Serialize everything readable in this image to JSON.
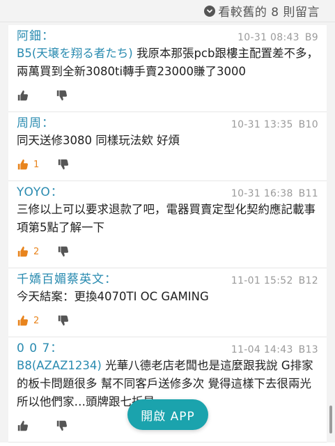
{
  "header": {
    "toggle_label": "看較舊的 8 則留言",
    "icon": "chevron-down-icon"
  },
  "comments": [
    {
      "author": "阿鈿：",
      "time": "10-31 08:43",
      "floor": "B9",
      "mention": "B5(天壌を翔る者たち)",
      "text": " 我原本那張pcb跟樓主配置差不多，兩萬買到全新3080ti轉手賣23000賺了3000",
      "likes": "",
      "liked": false
    },
    {
      "author": "周周：",
      "time": "10-31 13:35",
      "floor": "B10",
      "mention": "",
      "text": "同天送修3080 同樣玩法欸 好煩",
      "likes": "1",
      "liked": true
    },
    {
      "author": "YOYO：",
      "time": "10-31 16:38",
      "floor": "B11",
      "mention": "",
      "text": "三修以上可以要求退款了吧，電器買賣定型化契約應記載事項第5點了解一下",
      "likes": "2",
      "liked": true
    },
    {
      "author": "千嬌百媚蔡英文：",
      "time": "11-01 15:52",
      "floor": "B12",
      "mention": "",
      "text": "今天結案：更換4070TI OC GAMING",
      "likes": "2",
      "liked": true
    },
    {
      "author": "0 0 7：",
      "time": "11-04 14:43",
      "floor": "B13",
      "mention": "B8(AZAZ1234)",
      "text": " 光華八德老店老闆也是這麼跟我說 G排家的板卡問題很多 幫不同客戶送修多次 覺得這樣下去很兩光 所以他們家",
      "hidden_text": "…頭牌跟七折星",
      "likes": "",
      "liked": false
    }
  ],
  "open_app": {
    "label": "開啟 APP"
  },
  "colors": {
    "accent": "#2a8bb0",
    "like_active": "#e8841d",
    "button": "#1ba3ad"
  }
}
